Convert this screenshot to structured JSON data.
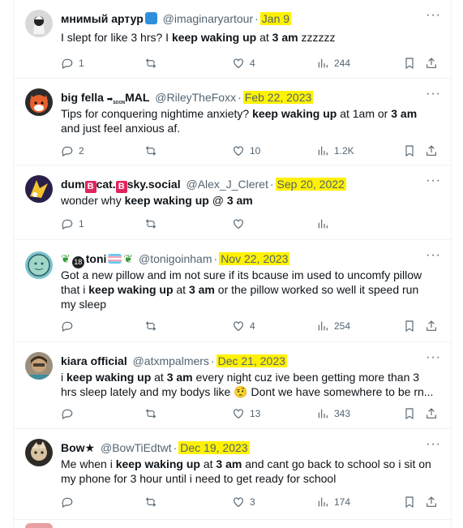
{
  "tweets": [
    {
      "name": "мнимый артур",
      "handle": "@imaginaryartour",
      "date": "Jan 9",
      "text_parts": [
        "I slept for like 3 hrs? I ",
        "keep waking up",
        " at ",
        "3 am",
        " zzzzzz"
      ],
      "replies": "1",
      "retweets": "",
      "likes": "4",
      "views": "244"
    },
    {
      "name": "big fella",
      "name_suffix": "MAL",
      "name_badge": "SOON",
      "handle": "@RileyTheFoxx",
      "date": "Feb 22, 2023",
      "text_parts": [
        "Tips for conquering nightime anxiety? ",
        "keep waking up",
        " at 1am or ",
        "3 am",
        " and just feel anxious af."
      ],
      "replies": "2",
      "retweets": "",
      "likes": "10",
      "views": "1.2K"
    },
    {
      "name_prefix": "dum",
      "name_badge1": "B",
      "name_mid": "cat.",
      "name_badge2": "B",
      "name": "sky.social",
      "handle": "@Alex_J_Cleret",
      "date": "Sep 20, 2022",
      "text_parts": [
        "wonder why ",
        "keep waking up",
        " @ ",
        "3 am",
        ""
      ],
      "replies": "1",
      "retweets": "",
      "likes": "",
      "views": ""
    },
    {
      "name": "toni",
      "name_badge": "18",
      "handle": "@tonigoinham",
      "date": "Nov 22, 2023",
      "text_parts": [
        "Got a new pillow and im not sure if its bcause im used to uncomfy pillow that i ",
        "keep waking up",
        " at ",
        "3 am",
        " or the pillow worked so well it speed run my sleep"
      ],
      "replies": "",
      "retweets": "",
      "likes": "4",
      "views": "254"
    },
    {
      "name": "kiara official",
      "handle": "@atxmpalmers",
      "date": "Dec 21, 2023",
      "text_parts": [
        "i ",
        "keep waking up",
        " at ",
        "3 am",
        " every night cuz ive been getting more than 3 hrs sleep lately and my bodys like 🤨 Dont we have somewhere to be rn..."
      ],
      "replies": "",
      "retweets": "",
      "likes": "13",
      "views": "343"
    },
    {
      "name": "Bow★",
      "handle": "@BowTiEdtwt",
      "date": "Dec 19, 2023",
      "text_parts": [
        "Me when i ",
        "keep waking up",
        " at ",
        "3 am",
        " and cant go back to school so i sit on my phone for 3 hour until i need to get ready for school"
      ],
      "replies": "",
      "retweets": "",
      "likes": "3",
      "views": "174"
    }
  ]
}
